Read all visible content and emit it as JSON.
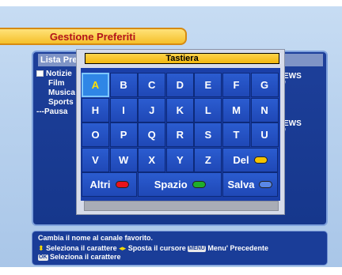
{
  "screen": {
    "title": "Gestione Preferiti"
  },
  "list": {
    "header": "Lista Pre",
    "items": [
      {
        "label": "Notizie",
        "folder": true
      },
      {
        "label": "Film",
        "folder": false
      },
      {
        "label": "Musica",
        "folder": false
      },
      {
        "label": "Sports",
        "folder": false
      },
      {
        "label": "---Pausa",
        "folder": false
      }
    ],
    "right_values": [
      "EWS",
      "/",
      "EWS",
      "/"
    ]
  },
  "keyboard": {
    "title": "Tastiera",
    "rows": [
      [
        "A",
        "B",
        "C",
        "D",
        "E",
        "F",
        "G"
      ],
      [
        "H",
        "I",
        "J",
        "K",
        "L",
        "M",
        "N"
      ],
      [
        "O",
        "P",
        "Q",
        "R",
        "S",
        "T",
        "U"
      ],
      [
        "V",
        "W",
        "X",
        "Y",
        "Z"
      ]
    ],
    "selected_key": "A",
    "del_label": "Del",
    "altri_label": "Altri",
    "spazio_label": "Spazio",
    "salva_label": "Salva",
    "input_value": "",
    "colors": {
      "del": "#f5c400",
      "altri": "#e8141b",
      "spazio": "#1fae2a",
      "salva": "#5a88e6"
    }
  },
  "help": {
    "line1": "Cambia il nome al canale favorito.",
    "line2_a": "Seleziona il carattere",
    "line2_b": "Sposta il cursore",
    "line2_menu": "MENU",
    "line2_c": "Menu' Precedente",
    "ok_label": "OK",
    "line3": "Seleziona il carattere"
  }
}
